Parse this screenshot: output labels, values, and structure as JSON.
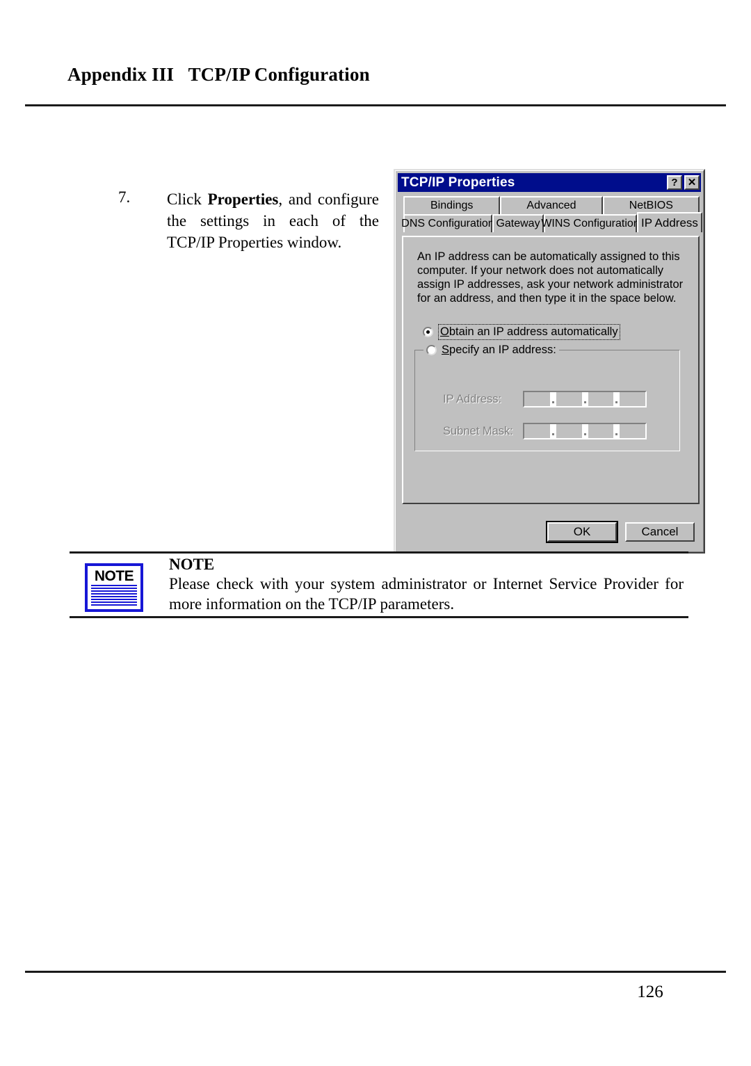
{
  "page": {
    "header_title": "Appendix III   TCP/IP Configuration",
    "page_number": "126"
  },
  "step": {
    "number": "7.",
    "line1_prefix": "Click ",
    "line1_bold": "Properties",
    "line1_suffix": ", and configure",
    "line2": "the settings in each of the",
    "line3": "TCP/IP Properties window."
  },
  "dialog": {
    "title": "TCP/IP Properties",
    "help_button": "?",
    "close_button": "✕",
    "tabs_row1": [
      {
        "label": "Bindings",
        "active": false
      },
      {
        "label": "Advanced",
        "active": false
      },
      {
        "label": "NetBIOS",
        "active": false
      }
    ],
    "tabs_row2": [
      {
        "label": "DNS Configuration",
        "active": false
      },
      {
        "label": "Gateway",
        "active": false
      },
      {
        "label": "WINS Configuration",
        "active": false
      },
      {
        "label": "IP Address",
        "active": true
      }
    ],
    "description": "An IP address can be automatically assigned to this computer. If your network does not automatically assign IP addresses, ask your network administrator for an address, and then type it in the space below.",
    "radio_auto": {
      "label_underlined": "O",
      "label_rest": "btain an IP address automatically",
      "selected": true
    },
    "radio_specify": {
      "label_prefix": "",
      "label_underlined": "S",
      "label_rest": "pecify an IP address:",
      "selected": false
    },
    "fields": [
      {
        "label": "IP Address:",
        "value": "",
        "enabled": false
      },
      {
        "label": "Subnet Mask:",
        "value": "",
        "enabled": false
      }
    ],
    "buttons": {
      "ok": "OK",
      "cancel": "Cancel"
    },
    "colors": {
      "titlebar": "#000d8c",
      "face": "#c0c0c0",
      "disabled_text": "#808080"
    }
  },
  "note": {
    "icon_word": "NOTE",
    "heading": "NOTE",
    "text": "Please check with your system administrator or Internet Service Provider for more information on the TCP/IP parameters.",
    "accent_color": "#1717d6"
  }
}
